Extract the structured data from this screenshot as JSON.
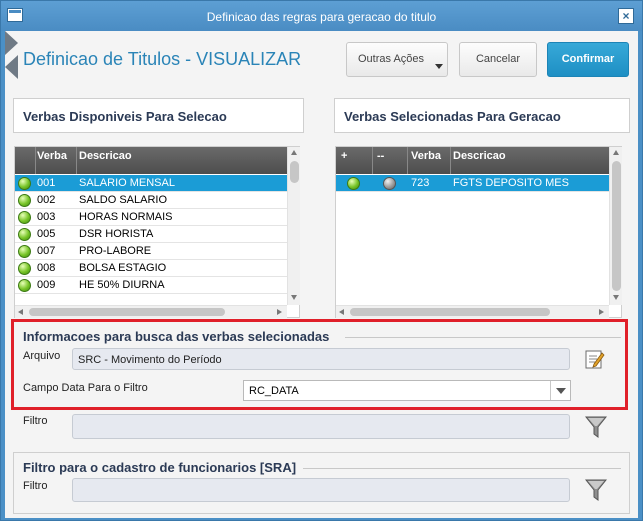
{
  "window": {
    "title": "Definicao das regras para geracao do titulo"
  },
  "header": {
    "title": "Definicao de Titulos - VISUALIZAR",
    "outras_label": "Outras Ações",
    "cancel_label": "Cancelar",
    "confirm_label": "Confirmar"
  },
  "left_panel": {
    "title": "Verbas Disponiveis Para Selecao",
    "columns": [
      "Verba",
      "Descricao"
    ],
    "rows": [
      {
        "verba": "001",
        "descricao": "SALARIO MENSAL",
        "selected": true
      },
      {
        "verba": "002",
        "descricao": "SALDO SALARIO",
        "selected": false
      },
      {
        "verba": "003",
        "descricao": "HORAS NORMAIS",
        "selected": false
      },
      {
        "verba": "005",
        "descricao": "DSR HORISTA",
        "selected": false
      },
      {
        "verba": "007",
        "descricao": "PRO-LABORE",
        "selected": false
      },
      {
        "verba": "008",
        "descricao": "BOLSA ESTAGIO",
        "selected": false
      },
      {
        "verba": "009",
        "descricao": "HE 50% DIURNA",
        "selected": false
      }
    ]
  },
  "right_panel": {
    "title": "Verbas Selecionadas Para Geracao",
    "columns": [
      "+",
      "--",
      "Verba",
      "Descricao"
    ],
    "rows": [
      {
        "verba": "723",
        "descricao": "FGTS DEPOSITO MES",
        "selected": true
      }
    ]
  },
  "busca": {
    "title": "Informacoes para busca das verbas selecionadas",
    "arquivo_label": "Arquivo",
    "arquivo_value": "SRC - Movimento do Período",
    "campo_label": "Campo Data Para o Filtro",
    "campo_value": "RC_DATA",
    "filtro_label": "Filtro",
    "filtro_value": ""
  },
  "cadastro": {
    "title": "Filtro para o cadastro de funcionarios [SRA]",
    "filtro_label": "Filtro",
    "filtro_value": ""
  },
  "colors": {
    "accent": "#2a84b7",
    "confirm": "#1e8fc4",
    "highlight": "#e0202a",
    "selection": "#1b9cd6"
  }
}
